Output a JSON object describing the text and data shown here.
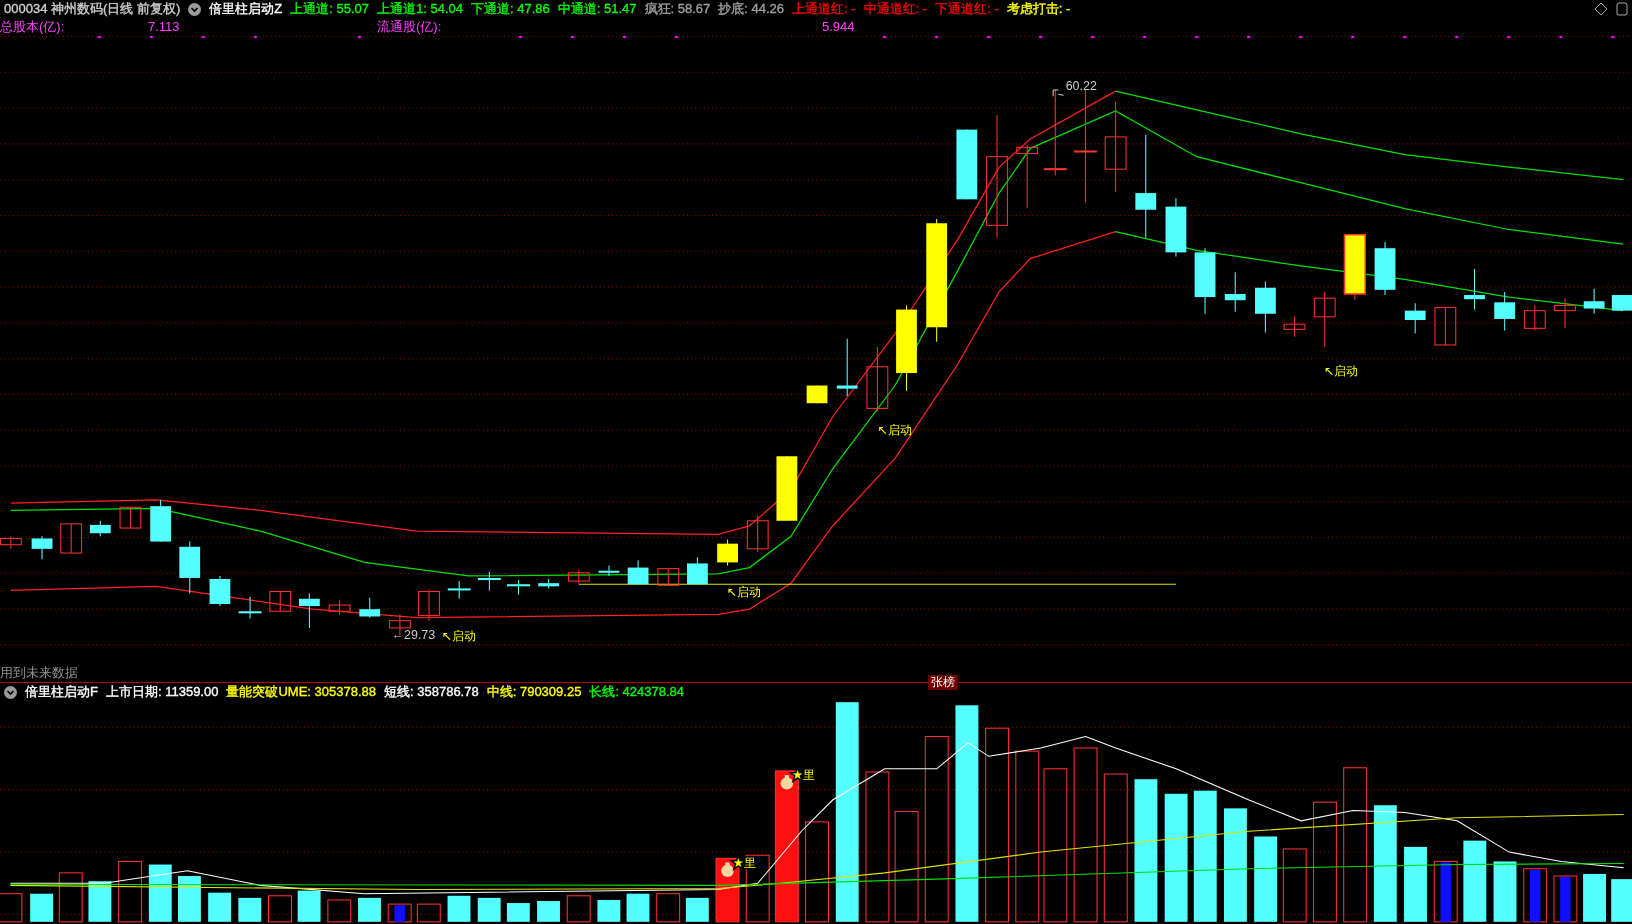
{
  "main_header": {
    "symbol": "000034 神州数码(日线 前复权)",
    "indicator": "倍里柱启动Z",
    "values": [
      {
        "text": "上通道: 55.07",
        "color": "#00ff00"
      },
      {
        "text": "上通道1: 54.04",
        "color": "#00ff00"
      },
      {
        "text": "下通道: 47.86",
        "color": "#00ff00"
      },
      {
        "text": "中通道: 51.47",
        "color": "#00ff00"
      },
      {
        "text": "疯狂: 58.67",
        "color": "#a0a0a0"
      },
      {
        "text": "抄底: 44.26",
        "color": "#a0a0a0"
      },
      {
        "text": "上通道红: -",
        "color": "#ff0000"
      },
      {
        "text": "中通道红: -",
        "color": "#ff0000"
      },
      {
        "text": "下通道红: -",
        "color": "#ff0000"
      },
      {
        "text": "考虑打击: -",
        "color": "#ffff00"
      }
    ]
  },
  "capital_row": [
    {
      "label": "总股本(亿):",
      "value": "7.113"
    },
    {
      "label": "流通股(亿):",
      "value": "5.944"
    }
  ],
  "main_chart": {
    "peak_label": "60.22",
    "low_label": "←29.73",
    "start_labels": [
      "↖启动",
      "↖启动",
      "↖启动",
      "↖启动"
    ]
  },
  "notice": "用到未来数据",
  "divider_badge": "张榜",
  "volume_header": {
    "indicator": "倍里柱启动F",
    "values": [
      {
        "text": "上市日期: 11359.00",
        "color": "#ffffff"
      },
      {
        "text": "量能突破UME: 305378.88",
        "color": "#ffff00"
      },
      {
        "text": "短线: 358786.78",
        "color": "#ffffff"
      },
      {
        "text": "中线: 790309.25",
        "color": "#ffff00"
      },
      {
        "text": "长线: 424378.84",
        "color": "#00ff00"
      }
    ]
  },
  "volume_chart": {
    "signal_labels": [
      "★里",
      "★里"
    ]
  }
}
